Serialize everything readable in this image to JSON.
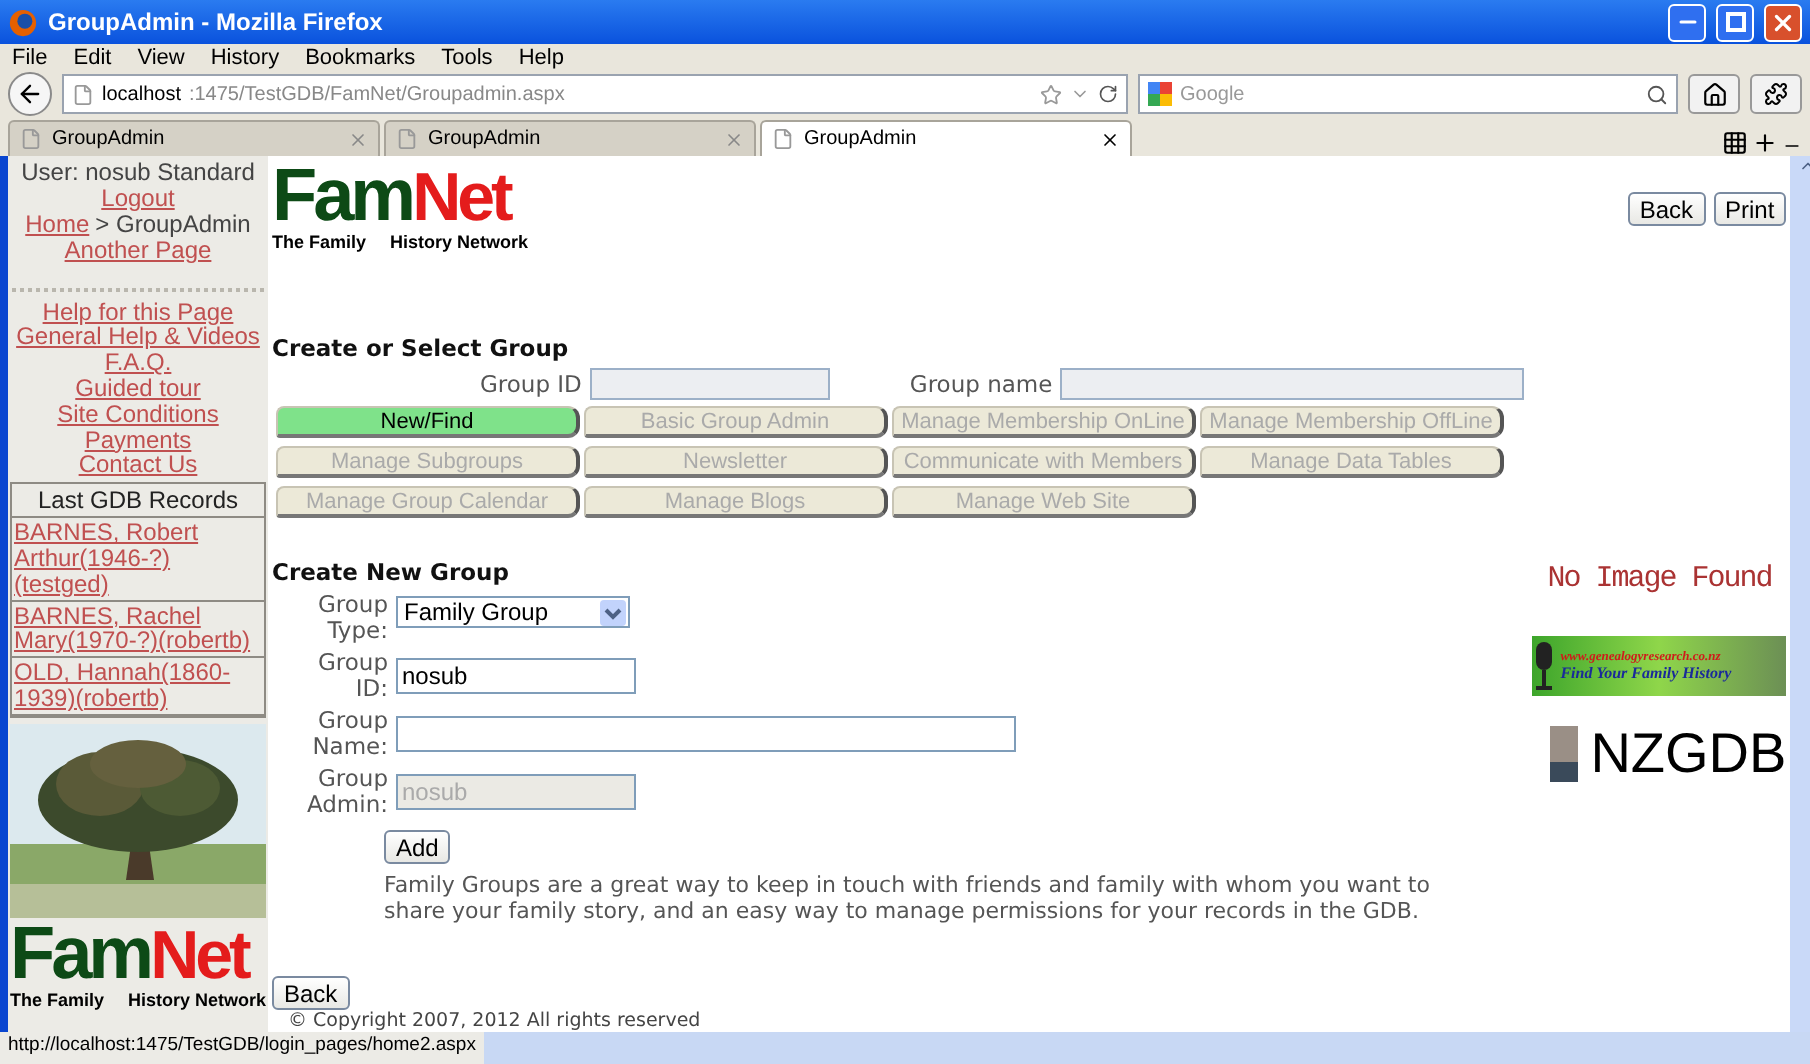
{
  "window": {
    "title": "GroupAdmin - Mozilla Firefox"
  },
  "menu": [
    "File",
    "Edit",
    "View",
    "History",
    "Bookmarks",
    "Tools",
    "Help"
  ],
  "address": {
    "host": "localhost",
    "path": ":1475/TestGDB/FamNet/Groupadmin.aspx"
  },
  "search": {
    "placeholder": "Google"
  },
  "tabs": [
    {
      "label": "GroupAdmin",
      "selected": false
    },
    {
      "label": "GroupAdmin",
      "selected": false
    },
    {
      "label": "GroupAdmin",
      "selected": true
    }
  ],
  "sidebar": {
    "user": "User: nosub Standard",
    "logout": "Logout",
    "home": "Home",
    "crumb": "> GroupAdmin",
    "another": "Another Page",
    "help_links": [
      "Help for this Page",
      "General Help & Videos",
      "F.A.Q.",
      "Guided tour",
      "Site Conditions",
      "Payments",
      "Contact Us"
    ],
    "records_title": "Last GDB Records",
    "records": [
      "BARNES, Robert Arthur(1946-?)(testged)",
      "BARNES, Rachel Mary(1970-?)(robertb)",
      "OLD, Hannah(1860-1939)(robertb)"
    ],
    "logo": {
      "fam": "Fam",
      "net": "Net",
      "left": "The Family",
      "right": "History Network"
    }
  },
  "header_logo": {
    "fam": "Fam",
    "net": "Net",
    "left": "The Family",
    "right": "History Network"
  },
  "top_buttons": [
    "Back",
    "Print"
  ],
  "select_group": {
    "heading": "Create or Select Group",
    "id_label": "Group ID",
    "name_label": "Group name",
    "buttons": [
      {
        "label": "New/Find",
        "selected": true
      },
      {
        "label": "Basic Group Admin",
        "selected": false
      },
      {
        "label": "Manage Membership OnLine",
        "selected": false
      },
      {
        "label": "Manage Membership OffLine",
        "selected": false
      },
      {
        "label": "Manage Subgroups",
        "selected": false
      },
      {
        "label": "Newsletter",
        "selected": false
      },
      {
        "label": "Communicate with Members",
        "selected": false
      },
      {
        "label": "Manage Data Tables",
        "selected": false
      },
      {
        "label": "Manage Group Calendar",
        "selected": false
      },
      {
        "label": "Manage Blogs",
        "selected": false
      },
      {
        "label": "Manage Web Site",
        "selected": false
      }
    ]
  },
  "new_group": {
    "heading": "Create New Group",
    "fields": [
      {
        "label": "Group Type:",
        "kind": "select",
        "value": "Family Group"
      },
      {
        "label": "Group ID:",
        "kind": "short",
        "value": "nosub",
        "disabled": false
      },
      {
        "label": "Group Name:",
        "kind": "long",
        "disabled": false
      },
      {
        "label": "Group Admin:",
        "kind": "short",
        "value": "nosub",
        "disabled": true
      }
    ],
    "add": "Add",
    "description": "Family Groups are a great way to keep in touch with friends and family with whom you want to share your family story, and an easy way to manage permissions for your records in the GDB."
  },
  "back": "Back",
  "copyright": "© Copyright 2007, 2012 All rights reserved",
  "ads": {
    "no_image": "No Image Found",
    "banner_url": "www.genealogyresearch.co.nz",
    "banner_tag": "Find Your Family History",
    "nzgdb": "NZGDB"
  },
  "status_bar": "http://localhost:1475/TestGDB/login_pages/home2.aspx"
}
